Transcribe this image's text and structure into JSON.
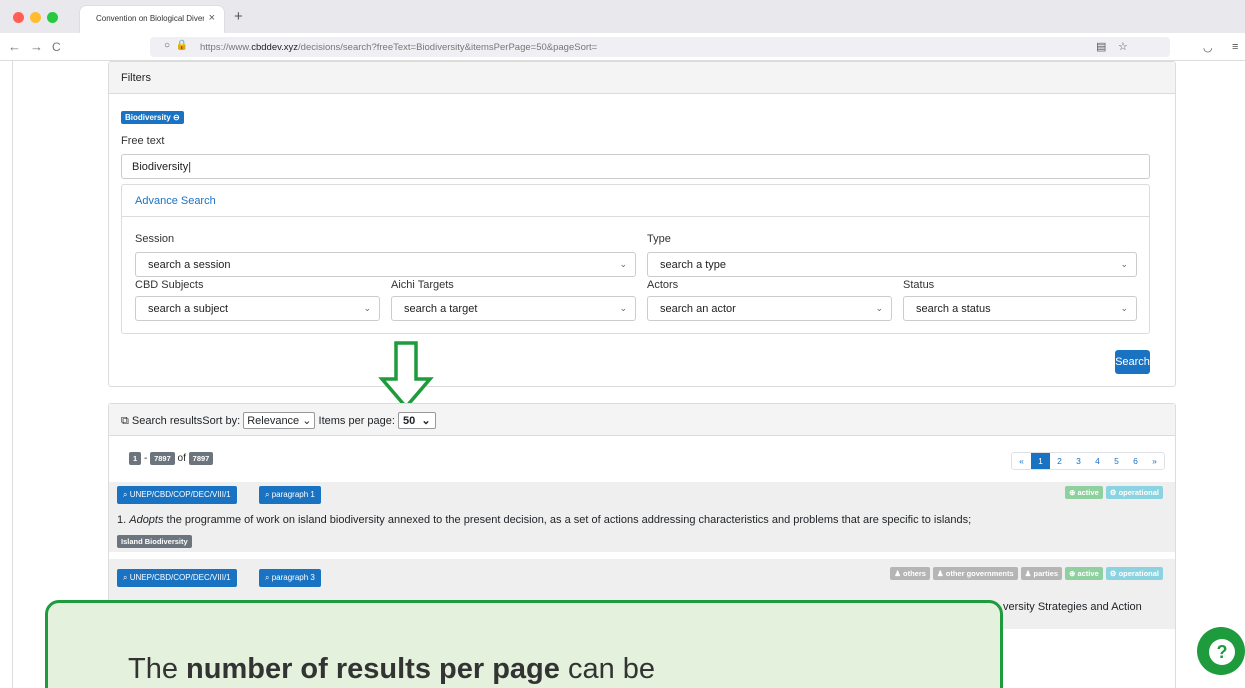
{
  "browser": {
    "tab_title": "Convention on Biological Diversi",
    "tab_close": "×",
    "new_tab": "+",
    "url_prefix": "https://www.",
    "url_domain": "cbddev.xyz",
    "url_rest": "/decisions/search?freeText=Biodiversity&itemsPerPage=50&pageSort=",
    "back": "←",
    "forward": "→",
    "reload": "C",
    "reader_icon": "▤",
    "star_icon": "☆",
    "pocket_icon": "◡",
    "menu_icon": "≡",
    "traffic_colors": [
      "#ff5f57",
      "#febc2e",
      "#28c840"
    ]
  },
  "filters": {
    "header": "Filters",
    "active_tag": "Biodiversity",
    "free_text_label": "Free text",
    "free_text_value": "Biodiversity",
    "advance_search": "Advance Search",
    "session_label": "Session",
    "session_value": "search a session",
    "type_label": "Type",
    "type_value": "search a type",
    "subjects_label": "CBD Subjects",
    "subjects_value": "search a subject",
    "aichi_label": "Aichi Targets",
    "aichi_value": "search a target",
    "actors_label": "Actors",
    "actors_value": "search an actor",
    "status_label": "Status",
    "status_value": "search a status",
    "search_button": "Search"
  },
  "results": {
    "header_label": "Search results",
    "sort_label": "Sort by:",
    "sort_value": "Relevance",
    "items_label": "Items per page:",
    "items_value": "50",
    "range_start": "1",
    "range_end": "7897",
    "of_label": "of",
    "total": "7897",
    "pages": [
      "«",
      "1",
      "2",
      "3",
      "4",
      "5",
      "6",
      "»"
    ],
    "items": [
      {
        "doc": "UNEP/CBD/COP/DEC/VIII/1",
        "para": "paragraph 1",
        "statuses": [
          "active",
          "operational"
        ],
        "text_prefix": "1. ",
        "text_italic": "Adopts",
        "text_rest": " the programme of work on island biodiversity annexed to the present decision, as a set of actions addressing characteristics and problems that are specific to islands;",
        "tag": "Island Biodiversity"
      },
      {
        "doc": "UNEP/CBD/COP/DEC/VIII/1",
        "para": "paragraph 3",
        "actors": [
          "others",
          "other governments",
          "parties"
        ],
        "statuses": [
          "active",
          "operational"
        ],
        "text_visible": "versity Strategies and Action"
      }
    ]
  },
  "callout": {
    "text_before": "The ",
    "text_bold": "number of results per page",
    "text_after": " can be"
  },
  "help_label": "?",
  "colors": {
    "primary": "#1a73c2",
    "green": "#1e9b3c",
    "callout_bg": "#e3f1dd"
  }
}
